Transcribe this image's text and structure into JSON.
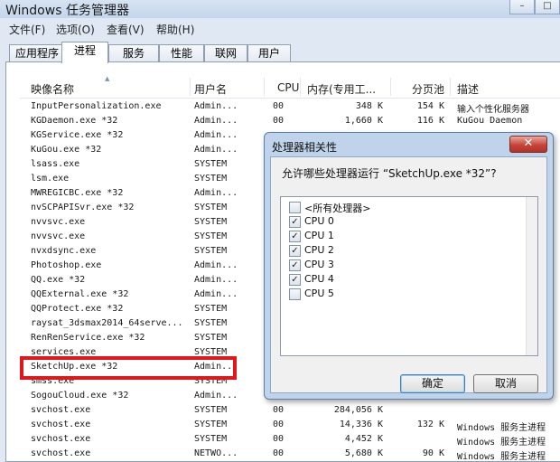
{
  "window": {
    "title": "Windows 任务管理器"
  },
  "window_controls": [
    "–",
    "□"
  ],
  "menu": [
    "文件(F)",
    "选项(O)",
    "查看(V)",
    "帮助(H)"
  ],
  "tabs": [
    "应用程序",
    "进程",
    "服务",
    "性能",
    "联网",
    "用户"
  ],
  "active_tab": "进程",
  "columns": {
    "name": "映像名称",
    "user": "用户名",
    "cpu": "CPU",
    "mem": "内存(专用工...",
    "page": "分页池",
    "desc": "描述"
  },
  "processes": [
    {
      "name": "InputPersonalization.exe",
      "user": "Admin...",
      "cpu": "00",
      "mem": "348 K",
      "page": "154 K",
      "desc": "输入个性化服务器"
    },
    {
      "name": "KGDaemon.exe *32",
      "user": "Admin...",
      "cpu": "00",
      "mem": "1,660 K",
      "page": "116 K",
      "desc": "KuGou Daemon"
    },
    {
      "name": "KGService.exe *32",
      "user": "Admin...",
      "cpu": "",
      "mem": "",
      "page": "",
      "desc": ""
    },
    {
      "name": "KuGou.exe *32",
      "user": "Admin...",
      "cpu": "",
      "mem": "",
      "page": "",
      "desc": ""
    },
    {
      "name": "lsass.exe",
      "user": "SYSTEM",
      "cpu": "",
      "mem": "",
      "page": "",
      "desc": ""
    },
    {
      "name": "lsm.exe",
      "user": "SYSTEM",
      "cpu": "",
      "mem": "",
      "page": "",
      "desc": ""
    },
    {
      "name": "MWREGICBC.exe *32",
      "user": "Admin...",
      "cpu": "",
      "mem": "",
      "page": "",
      "desc": ""
    },
    {
      "name": "nvSCPAPISvr.exe *32",
      "user": "SYSTEM",
      "cpu": "",
      "mem": "",
      "page": "",
      "desc": ""
    },
    {
      "name": "nvvsvc.exe",
      "user": "SYSTEM",
      "cpu": "",
      "mem": "",
      "page": "",
      "desc": ""
    },
    {
      "name": "nvvsvc.exe",
      "user": "SYSTEM",
      "cpu": "",
      "mem": "",
      "page": "",
      "desc": ""
    },
    {
      "name": "nvxdsync.exe",
      "user": "SYSTEM",
      "cpu": "",
      "mem": "",
      "page": "",
      "desc": ""
    },
    {
      "name": "Photoshop.exe",
      "user": "Admin...",
      "cpu": "",
      "mem": "",
      "page": "",
      "desc": ""
    },
    {
      "name": "QQ.exe *32",
      "user": "Admin...",
      "cpu": "",
      "mem": "",
      "page": "",
      "desc": ""
    },
    {
      "name": "QQExternal.exe *32",
      "user": "Admin...",
      "cpu": "",
      "mem": "",
      "page": "",
      "desc": ""
    },
    {
      "name": "QQProtect.exe *32",
      "user": "SYSTEM",
      "cpu": "",
      "mem": "",
      "page": "",
      "desc": ""
    },
    {
      "name": "raysat_3dsmax2014_64serve...",
      "user": "SYSTEM",
      "cpu": "",
      "mem": "",
      "page": "",
      "desc": ""
    },
    {
      "name": "RenRenService.exe *32",
      "user": "SYSTEM",
      "cpu": "",
      "mem": "",
      "page": "",
      "desc": ""
    },
    {
      "name": "services.exe",
      "user": "SYSTEM",
      "cpu": "",
      "mem": "",
      "page": "",
      "desc": ""
    },
    {
      "name": "SketchUp.exe *32",
      "user": "Admin...",
      "cpu": "",
      "mem": "",
      "page": "",
      "desc": ""
    },
    {
      "name": "smss.exe",
      "user": "SYSTEM",
      "cpu": "",
      "mem": "",
      "page": "",
      "desc": ""
    },
    {
      "name": "SogouCloud.exe *32",
      "user": "Admin...",
      "cpu": "",
      "mem": "",
      "page": "",
      "desc": ""
    },
    {
      "name": "svchost.exe",
      "user": "SYSTEM",
      "cpu": "00",
      "mem": "284,056 K",
      "page": "",
      "desc": ""
    },
    {
      "name": "svchost.exe",
      "user": "SYSTEM",
      "cpu": "00",
      "mem": "14,336 K",
      "page": "132 K",
      "desc": "Windows 服务主进程"
    },
    {
      "name": "svchost.exe",
      "user": "SYSTEM",
      "cpu": "00",
      "mem": "4,452 K",
      "page": "",
      "desc": "Windows 服务主进程"
    },
    {
      "name": "svchost.exe",
      "user": "NETWO...",
      "cpu": "00",
      "mem": "5,680 K",
      "page": "90 K",
      "desc": "Windows 服务主进程"
    }
  ],
  "dialog": {
    "title": "处理器相关性",
    "close": "✕",
    "question": "允许哪些处理器运行 “SketchUp.exe *32”?",
    "options": [
      {
        "label": "<所有处理器>",
        "checked": false
      },
      {
        "label": "CPU 0",
        "checked": true
      },
      {
        "label": "CPU 1",
        "checked": true
      },
      {
        "label": "CPU 2",
        "checked": true
      },
      {
        "label": "CPU 3",
        "checked": true
      },
      {
        "label": "CPU 4",
        "checked": true
      },
      {
        "label": "CPU 5",
        "checked": false
      }
    ],
    "ok": "确定",
    "cancel": "取消"
  },
  "colors": {
    "highlight_border": "#e2171b",
    "window_frame": "#dfe8f3",
    "dialog_frame": "#bfd3ea"
  }
}
